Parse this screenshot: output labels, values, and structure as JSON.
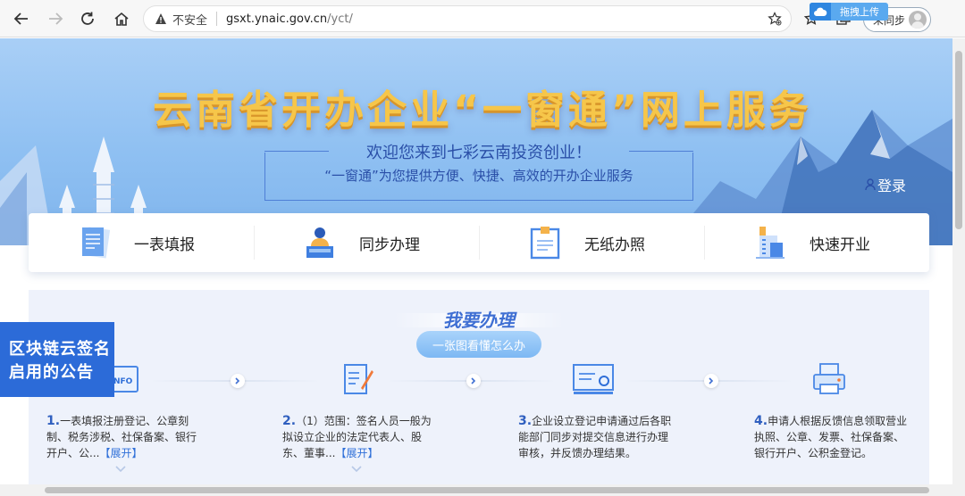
{
  "browser": {
    "address": {
      "warning_icon": "warning-triangle-icon",
      "insecure_label": "不安全",
      "host": "gsxt.ynaic.gov.cn",
      "path": "/yct/"
    },
    "sync_label": "未同步",
    "upload_widget_label": "拖拽上传"
  },
  "hero": {
    "title": "云南省开办企业“一窗通”网上服务",
    "welcome": "欢迎您来到七彩云南投资创业！",
    "subtitle": "“一窗通”为您提供方便、快捷、高效的开办企业服务",
    "login": "登录"
  },
  "features": [
    {
      "label": "一表填报",
      "icon": "form-document-icon"
    },
    {
      "label": "同步办理",
      "icon": "clerk-desk-icon"
    },
    {
      "label": "无纸办照",
      "icon": "license-certificate-icon"
    },
    {
      "label": "快速开业",
      "icon": "building-icon"
    }
  ],
  "process": {
    "title": "我要办理",
    "chart_button": "一张图看懂怎么办",
    "steps": [
      {
        "num": "1.",
        "text": "一表填报注册登记、公章刻制、税务涉税、社保备案、银行开户、公...",
        "expand": "【展开】",
        "icon": "info-card-icon"
      },
      {
        "num": "2.",
        "text": "（1）范围：签名人员一般为拟设立企业的法定代表人、股东、董事...",
        "expand": "【展开】",
        "icon": "sign-form-icon"
      },
      {
        "num": "3.",
        "text": "企业设立登记申请通过后各职能部门同步对提交信息进行办理审核，并反馈办理结果。",
        "expand": "",
        "icon": "monitor-review-icon"
      },
      {
        "num": "4.",
        "text": "申请人根据反馈信息领取营业执照、公章、发票、社保备案、银行开户、公积金登记。",
        "expand": "",
        "icon": "printer-icon"
      }
    ]
  },
  "notice": {
    "line1": "区块链云签名",
    "line2": "启用的公告"
  },
  "colors": {
    "accent": "#3f6fd3",
    "hero_title": "#f6c64a",
    "notice_bg": "#2c6bd8"
  }
}
